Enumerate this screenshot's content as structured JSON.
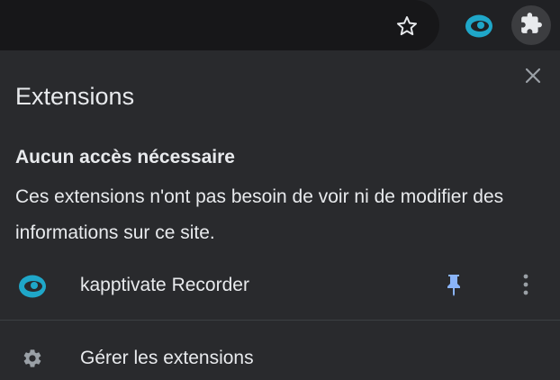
{
  "panel": {
    "title": "Extensions",
    "section_heading": "Aucun accès nécessaire",
    "section_description": "Ces extensions n'ont pas besoin de voir ni de modifier des informations sur ce site.",
    "extensions": [
      {
        "name": "kapptivate Recorder",
        "icon": "eye-icon",
        "pinned": true
      }
    ],
    "manage_label": "Gérer les extensions"
  },
  "icons": {
    "bookmark": "star-icon",
    "extensions_menu": "puzzle-icon",
    "close": "close-icon",
    "pin": "pin-icon",
    "more": "more-vert-icon",
    "settings": "gear-icon"
  },
  "colors": {
    "panel_bg": "#292a2d",
    "toolbar_bg": "#202124",
    "text": "#e8eaed",
    "accent_teal": "#1fa7c9",
    "pin_blue": "#8ab4f8",
    "icon_gray": "#9aa0a6"
  }
}
